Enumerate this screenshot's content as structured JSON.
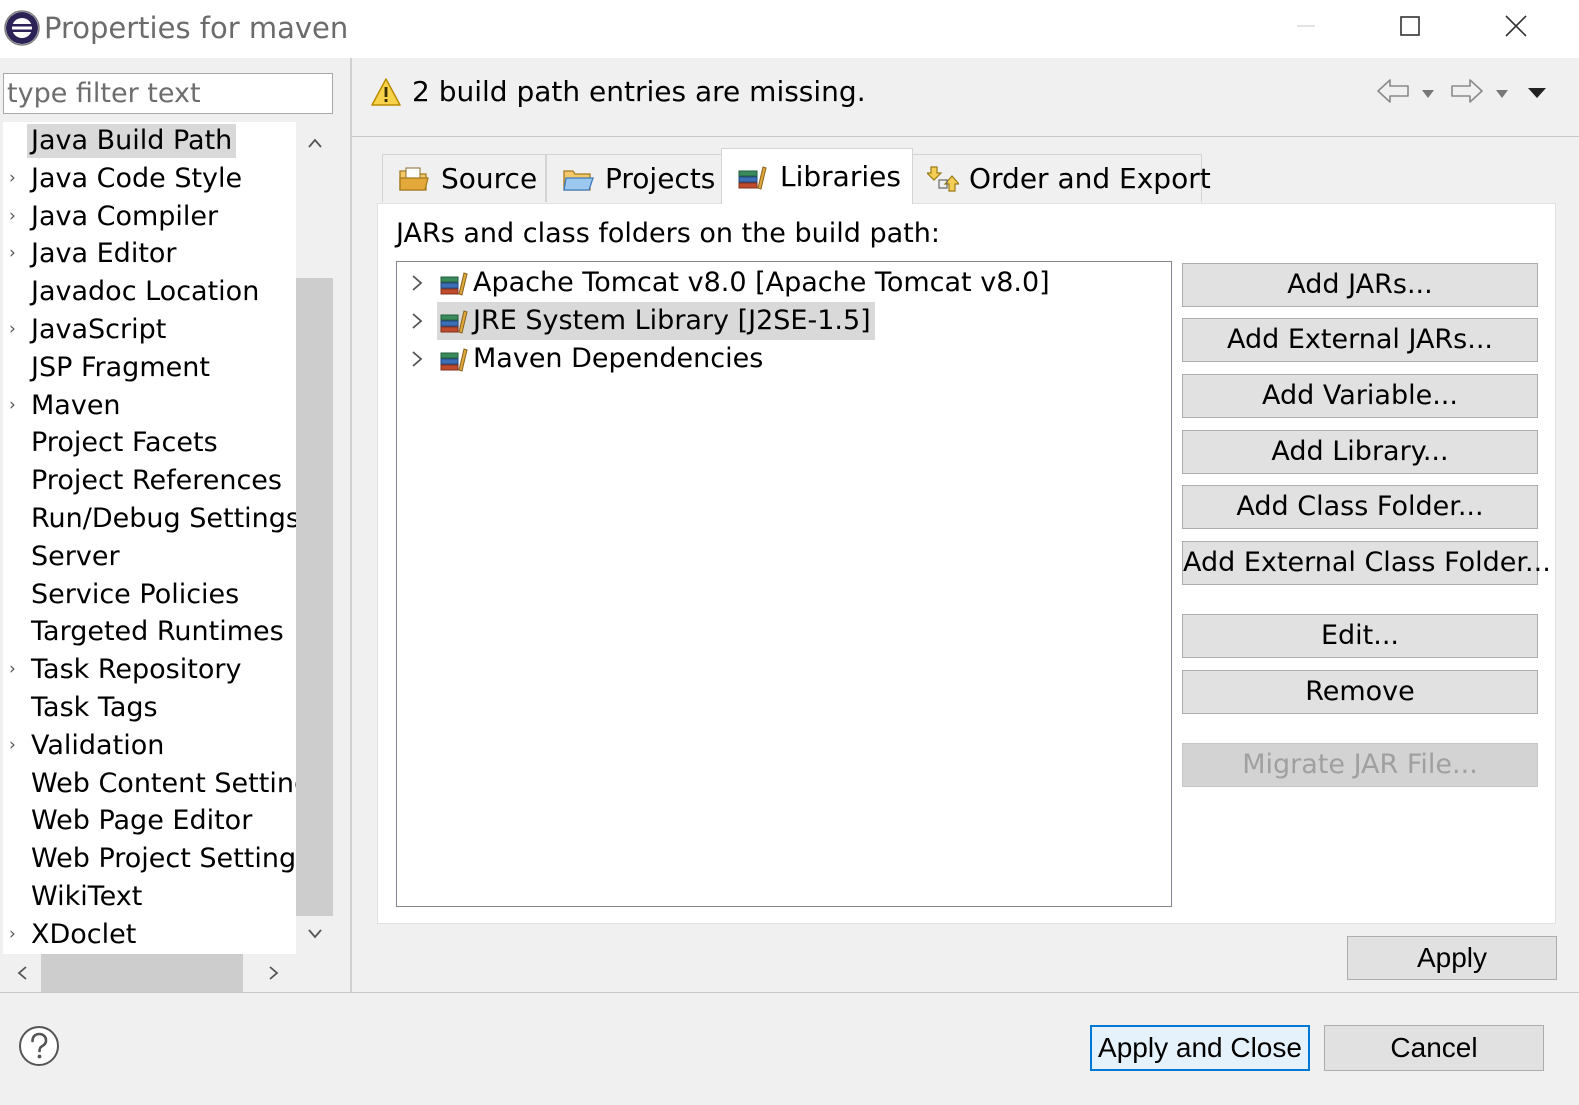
{
  "window": {
    "title": "Properties for maven",
    "controls": {
      "minimize_icon": "minimize-icon",
      "maximize_icon": "maximize-icon",
      "close_icon": "close-icon"
    }
  },
  "filter": {
    "placeholder": "type filter text",
    "value": ""
  },
  "nav_tree": {
    "items": [
      {
        "label": "Java Build Path",
        "expandable": false,
        "selected": true
      },
      {
        "label": "Java Code Style",
        "expandable": true
      },
      {
        "label": "Java Compiler",
        "expandable": true
      },
      {
        "label": "Java Editor",
        "expandable": true
      },
      {
        "label": "Javadoc Location",
        "expandable": false
      },
      {
        "label": "JavaScript",
        "expandable": true
      },
      {
        "label": "JSP Fragment",
        "expandable": false
      },
      {
        "label": "Maven",
        "expandable": true
      },
      {
        "label": "Project Facets",
        "expandable": false
      },
      {
        "label": "Project References",
        "expandable": false
      },
      {
        "label": "Run/Debug Settings",
        "expandable": false
      },
      {
        "label": "Server",
        "expandable": false
      },
      {
        "label": "Service Policies",
        "expandable": false
      },
      {
        "label": "Targeted Runtimes",
        "expandable": false
      },
      {
        "label": "Task Repository",
        "expandable": true
      },
      {
        "label": "Task Tags",
        "expandable": false
      },
      {
        "label": "Validation",
        "expandable": true
      },
      {
        "label": "Web Content Settings",
        "expandable": false
      },
      {
        "label": "Web Page Editor",
        "expandable": false
      },
      {
        "label": "Web Project Settings",
        "expandable": false
      },
      {
        "label": "WikiText",
        "expandable": false
      },
      {
        "label": "XDoclet",
        "expandable": true
      }
    ]
  },
  "header": {
    "message": "2 build path entries are missing.",
    "message_icon": "warning-icon"
  },
  "tabs": [
    {
      "label": "Source",
      "icon": "source-folder-icon",
      "active": false
    },
    {
      "label": "Projects",
      "icon": "projects-folder-icon",
      "active": false
    },
    {
      "label": "Libraries",
      "icon": "libraries-icon",
      "active": true
    },
    {
      "label": "Order and Export",
      "icon": "order-export-icon",
      "active": false
    }
  ],
  "libraries": {
    "label": "JARs and class folders on the build path:",
    "entries": [
      {
        "label": "Apache Tomcat v8.0 [Apache Tomcat v8.0]",
        "selected": false
      },
      {
        "label": "JRE System Library [J2SE-1.5]",
        "selected": true
      },
      {
        "label": "Maven Dependencies",
        "selected": false
      }
    ],
    "buttons": {
      "add_jars": "Add JARs...",
      "add_external_jars": "Add External JARs...",
      "add_variable": "Add Variable...",
      "add_library": "Add Library...",
      "add_class_folder": "Add Class Folder...",
      "add_external_class_folder": "Add External Class Folder...",
      "edit": "Edit...",
      "remove": "Remove",
      "migrate_jar": "Migrate JAR File..."
    }
  },
  "footer": {
    "apply": "Apply",
    "apply_and_close": "Apply and Close",
    "cancel": "Cancel",
    "help_icon": "help-icon"
  },
  "colors": {
    "selection": "#d9d9d9",
    "default_button_border": "#0078d7",
    "warning": "#f5c211"
  }
}
